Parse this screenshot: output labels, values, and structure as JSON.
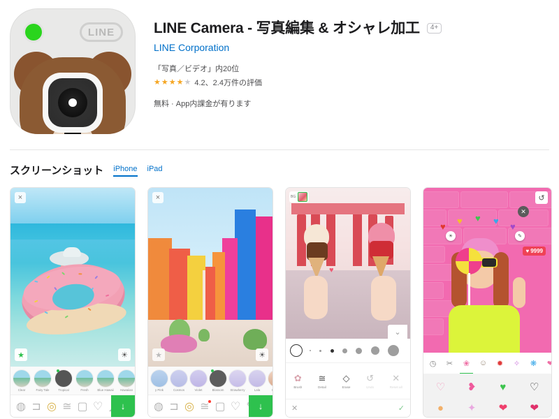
{
  "app": {
    "title": "LINE Camera - 写真編集 & オシャレ加工",
    "age_rating": "4+",
    "developer": "LINE Corporation",
    "rank": "「写真／ビデオ」内20位",
    "rating_value": "4.2、2.4万件の評価",
    "stars_filled": 4,
    "stars_total": 5,
    "price": "無料 · App内課金が有ります",
    "icon": {
      "brand_label": "LINE",
      "accent_green": "#2ad51d",
      "bg_color": "#e9e9e8",
      "bear_color": "#8b5a33"
    }
  },
  "screenshots_section": {
    "title": "スクリーンショット",
    "tabs": [
      {
        "label": "iPhone",
        "active": true
      },
      {
        "label": "iPad",
        "active": false
      }
    ],
    "shots": [
      {
        "name": "beach-donut-filter",
        "close_icon": "×",
        "badge_left": "★",
        "badge_right": "☀",
        "filters": [
          {
            "label": "Clear",
            "selected": false
          },
          {
            "label": "Fairy Tale",
            "selected": false
          },
          {
            "label": "Tropical",
            "selected": true
          },
          {
            "label": "Fresh",
            "selected": false
          },
          {
            "label": "Blue Hawaii",
            "selected": false
          },
          {
            "label": "Hawaiian",
            "selected": false
          }
        ],
        "toolbar": [
          "beauty-icon",
          "crop-icon",
          "filter-icon",
          "adjust-icon",
          "frame-icon",
          "heart-icon",
          "draw-icon"
        ],
        "save_icon": "↓",
        "save_color": "#2ec14e"
      },
      {
        "name": "colorful-houses-filter",
        "close_icon": "×",
        "badge_left": "★",
        "badge_right": "☀",
        "filters": [
          {
            "label": "y Pink",
            "selected": false
          },
          {
            "label": "Cosmos",
            "selected": false
          },
          {
            "label": "Violet",
            "selected": false
          },
          {
            "label": "Blossom",
            "selected": true
          },
          {
            "label": "Strawberry",
            "selected": false
          },
          {
            "label": "Lala",
            "selected": false
          },
          {
            "label": "Beauty",
            "selected": false
          }
        ],
        "toolbar": [
          "beauty-icon",
          "crop-icon",
          "filter-icon",
          "adjust-icon",
          "frame-icon",
          "heart-icon",
          "brush-icon"
        ],
        "save_icon": "↓",
        "save_color": "#2ec14e",
        "has_notification_dot": true
      },
      {
        "name": "ice-cream-background-blur",
        "bg_label": "BG",
        "chevron_icon": "⌄",
        "brush_sizes": [
          2,
          3,
          4,
          6,
          8,
          10,
          13
        ],
        "selected_brush_size_index": 2,
        "tools": [
          {
            "label": "Brush",
            "enabled": true
          },
          {
            "label": "Detail",
            "enabled": true
          },
          {
            "label": "Erase",
            "enabled": true
          },
          {
            "label": "Undo",
            "enabled": false
          },
          {
            "label": "Reset all",
            "enabled": false
          }
        ],
        "cancel_icon": "✕",
        "confirm_icon": "✓"
      },
      {
        "name": "pink-wall-stickers",
        "undo_icon": "↺",
        "like_count": "9999",
        "like_icon": "♥",
        "sticker_categories": [
          "clock-icon",
          "scissors-icon",
          "hearts-sticker",
          "bear-sticker",
          "crab-sticker",
          "unicorn-sticker",
          "balloon-sticker",
          "dog-sticker",
          "more-sticker"
        ],
        "active_category_index": 2,
        "sticker_items": [
          "heart-swirl",
          "heart-burst",
          "rainbow-hearts",
          "heart-speech-bubble",
          "peach",
          "unicorn",
          "lips",
          "kiss-lips"
        ],
        "control_close_icon": "✕",
        "control_brightness_icon": "☀",
        "control_edit_icon": "✎"
      }
    ]
  }
}
